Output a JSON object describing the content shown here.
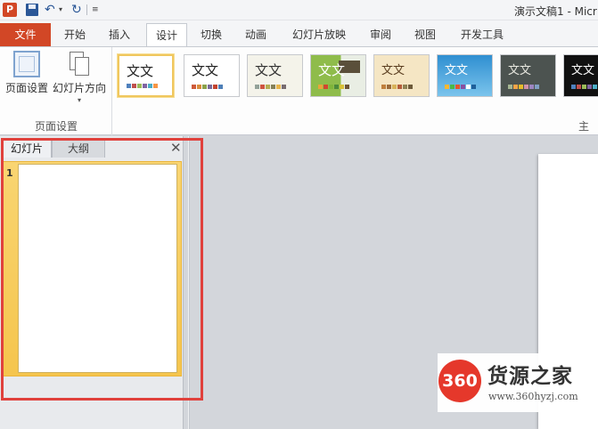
{
  "quick_access": {
    "app_icon_letter": "P",
    "undo_icon": "undo-icon",
    "redo_icon": "redo-icon",
    "save_icon": "save-icon"
  },
  "window": {
    "title": "演示文稿1 - Micr"
  },
  "tabs": {
    "file": "文件",
    "items": [
      "开始",
      "插入",
      "设计",
      "切换",
      "动画",
      "幻灯片放映",
      "审阅",
      "视图",
      "开发工具"
    ],
    "active": "设计"
  },
  "ribbon": {
    "page_setup": {
      "page_setup_label": "页面设置",
      "orientation_label": "幻灯片方向",
      "group_caption": "页面设置"
    },
    "themes": {
      "caption": "主题",
      "items": [
        {
          "label": "文文",
          "selected": true
        },
        {
          "label": "文文"
        },
        {
          "label": "文文"
        },
        {
          "label": "文文"
        },
        {
          "label": "文文"
        },
        {
          "label": "文文"
        },
        {
          "label": "文文"
        },
        {
          "label": "文文"
        }
      ]
    }
  },
  "slide_panel": {
    "tab_slides": "幻灯片",
    "tab_outline": "大纲",
    "close_glyph": "✕",
    "slide_number": "1"
  },
  "watermark": {
    "logo_text": "360",
    "name": "货源之家",
    "url": "www.360hyzj.com"
  },
  "colors": {
    "file_tab": "#d24726",
    "highlight_border": "#e0413c",
    "selected_thumb": "#f5c54d"
  }
}
